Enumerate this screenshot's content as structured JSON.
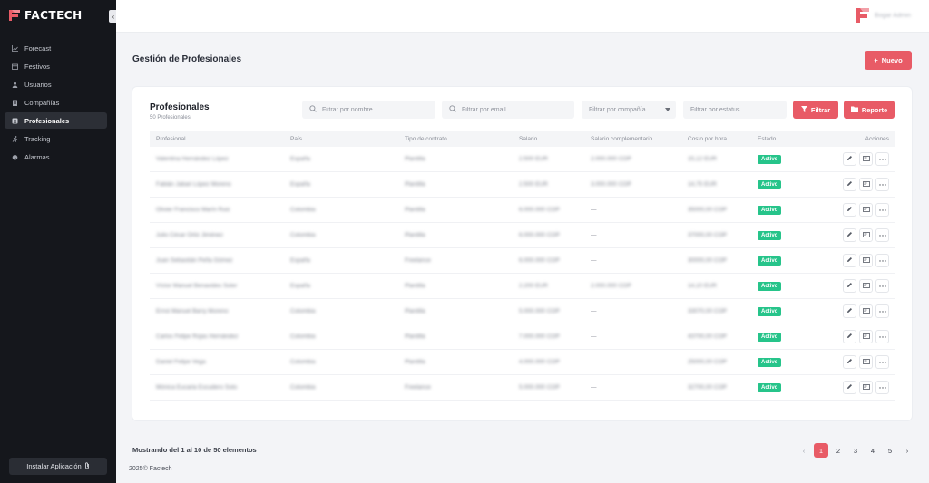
{
  "app": {
    "logo_text": "FACTECH",
    "brand_color": "#e85b66"
  },
  "sidebar": {
    "items": [
      {
        "label": "Forecast",
        "icon": "chart-line-icon",
        "active": false
      },
      {
        "label": "Festivos",
        "icon": "calendar-icon",
        "active": false
      },
      {
        "label": "Usuarios",
        "icon": "users-icon",
        "active": false
      },
      {
        "label": "Compañías",
        "icon": "building-icon",
        "active": false
      },
      {
        "label": "Profesionales",
        "icon": "id-badge-icon",
        "active": true
      },
      {
        "label": "Tracking",
        "icon": "running-icon",
        "active": false
      },
      {
        "label": "Alarmas",
        "icon": "alarm-icon",
        "active": false
      }
    ],
    "install_label": "Instalar Aplicación"
  },
  "topbar": {
    "user_name": "Bogar Admin"
  },
  "page": {
    "title": "Gestión de Profesionales",
    "new_button": "Nuevo"
  },
  "card": {
    "title": "Profesionales",
    "subtitle": "50 Profesionales",
    "filters": {
      "name_placeholder": "Filtrar por nombre...",
      "email_placeholder": "Filtrar por email...",
      "company_placeholder": "Filtrar por compañía",
      "status_placeholder": "Filtrar por estatus"
    },
    "filter_button": "Filtrar",
    "report_button": "Reporte"
  },
  "table": {
    "headers": [
      "Profesional",
      "País",
      "Tipo de contrato",
      "Salario",
      "Salario complementario",
      "Costo por hora",
      "Estado",
      "Acciones"
    ],
    "rows": [
      {
        "name": "Valentina Hernández López",
        "country": "España",
        "contract": "Plantilla",
        "salary": "2.500 EUR",
        "salary_comp": "2.000.000 COP",
        "cost": "15,12 EUR",
        "status": "Activo"
      },
      {
        "name": "Fabián Jabari López Moreno",
        "country": "España",
        "contract": "Plantilla",
        "salary": "2.500 EUR",
        "salary_comp": "3.000.000 COP",
        "cost": "14,75 EUR",
        "status": "Activo"
      },
      {
        "name": "Olivier Francisco Marín Ruiz",
        "country": "Colombia",
        "contract": "Plantilla",
        "salary": "6.000.000 COP",
        "salary_comp": "—",
        "cost": "35000,00 COP",
        "status": "Activo"
      },
      {
        "name": "Julio César Ortiz Jiménez",
        "country": "Colombia",
        "contract": "Plantilla",
        "salary": "6.000.000 COP",
        "salary_comp": "—",
        "cost": "37000,00 COP",
        "status": "Activo"
      },
      {
        "name": "Juan Sebastián Peña Gómez",
        "country": "España",
        "contract": "Freelance",
        "salary": "6.000.000 COP",
        "salary_comp": "—",
        "cost": "30000,00 COP",
        "status": "Activo"
      },
      {
        "name": "Víctor Manuel Benavides Soler",
        "country": "España",
        "contract": "Plantilla",
        "salary": "2.200 EUR",
        "salary_comp": "2.000.000 COP",
        "cost": "14,10 EUR",
        "status": "Activo"
      },
      {
        "name": "Ernst Manuel Barry Moreno",
        "country": "Colombia",
        "contract": "Plantilla",
        "salary": "5.000.000 COP",
        "salary_comp": "—",
        "cost": "33070,00 COP",
        "status": "Activo"
      },
      {
        "name": "Carlos Felipe Rojas Hernández",
        "country": "Colombia",
        "contract": "Plantilla",
        "salary": "7.000.000 COP",
        "salary_comp": "—",
        "cost": "43700,00 COP",
        "status": "Activo"
      },
      {
        "name": "Daniel Felipe Vega",
        "country": "Colombia",
        "contract": "Plantilla",
        "salary": "4.000.000 COP",
        "salary_comp": "—",
        "cost": "25000,00 COP",
        "status": "Activo"
      },
      {
        "name": "Mónica Eucaria Escudero Soto",
        "country": "Colombia",
        "contract": "Freelance",
        "salary": "5.000.000 COP",
        "salary_comp": "—",
        "cost": "32700,00 COP",
        "status": "Activo"
      }
    ]
  },
  "pagination": {
    "showing": "Mostrando del 1 al 10 de 50 elementos",
    "pages": [
      "1",
      "2",
      "3",
      "4",
      "5"
    ],
    "current": "1"
  },
  "footer": {
    "text": "2025© Factech"
  }
}
